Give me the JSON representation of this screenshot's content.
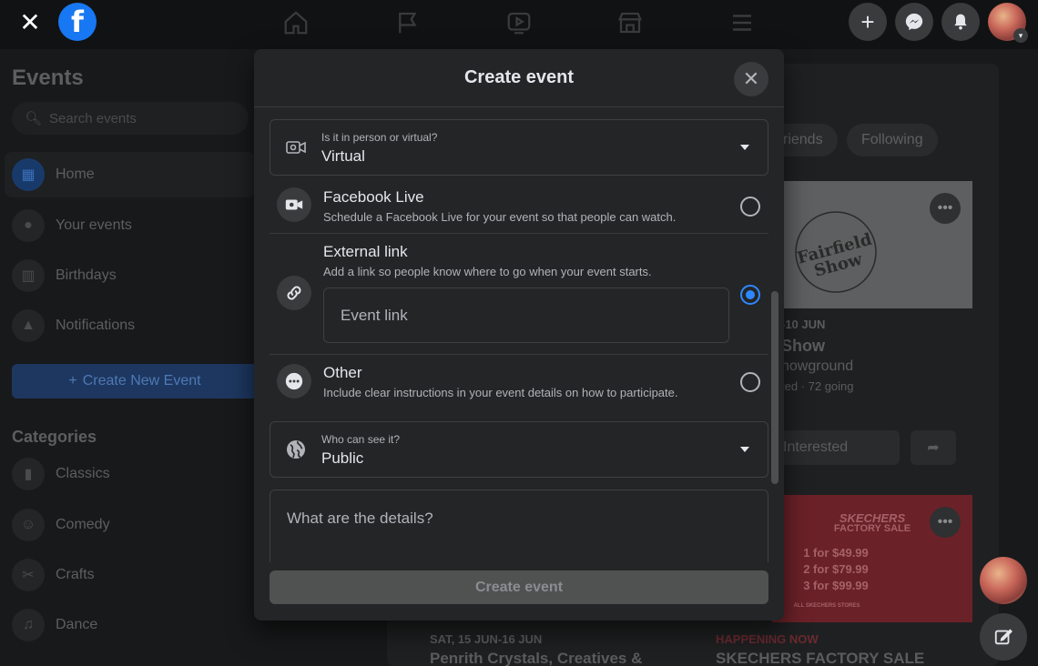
{
  "topbar": {
    "close_glyph": "✕",
    "logo_glyph": "f",
    "nav_icons": [
      "home-icon",
      "flag-icon",
      "video-icon",
      "marketplace-icon",
      "menu-icon"
    ],
    "create_glyph": "+"
  },
  "sidebar": {
    "title": "Events",
    "search_placeholder": "Search events",
    "items": [
      {
        "label": "Home",
        "icon": "calendar-icon"
      },
      {
        "label": "Your events",
        "icon": "person-icon"
      },
      {
        "label": "Birthdays",
        "icon": "cake-icon"
      },
      {
        "label": "Notifications",
        "icon": "bell-icon"
      }
    ],
    "create_new_label": "Create New Event",
    "categories_title": "Categories",
    "categories": [
      "Classics",
      "Comedy",
      "Crafts",
      "Dance"
    ]
  },
  "background": {
    "pills": [
      "riends",
      "Following"
    ],
    "card1": {
      "date": "-10 JUN",
      "title": "Show",
      "place": "howground",
      "stats": "ted · 72 going",
      "interested": "Interested",
      "logo_text": "Fairfield Show"
    },
    "card2": {
      "banner_title": "SKECHERS",
      "banner_sub": "FACTORY SALE",
      "prices": [
        "1 for $49.99",
        "2 for $79.99",
        "3 for $99.99"
      ],
      "banner_note": "ALL SKECHERS STORES",
      "status": "HAPPENING NOW",
      "title": "SKECHERS FACTORY SALE"
    },
    "card3": {
      "date": "SAT, 15 JUN-16 JUN",
      "title": "Penrith Crystals, Creatives &"
    }
  },
  "modal": {
    "title": "Create event",
    "location_field": {
      "label": "Is it in person or virtual?",
      "value": "Virtual"
    },
    "options": [
      {
        "title": "Facebook Live",
        "desc": "Schedule a Facebook Live for your event so that people can watch.",
        "selected": false
      },
      {
        "title": "External link",
        "desc": "Add a link so people know where to go when your event starts.",
        "selected": true
      },
      {
        "title": "Other",
        "desc": "Include clear instructions in your event details on how to participate.",
        "selected": false
      }
    ],
    "event_link_placeholder": "Event link",
    "privacy_field": {
      "label": "Who can see it?",
      "value": "Public"
    },
    "details_placeholder": "What are the details?",
    "submit_label": "Create event"
  },
  "colors": {
    "accent": "#2d88ff",
    "brand": "#1877f2",
    "modal_bg": "#242526",
    "page_bg": "#18191a"
  }
}
